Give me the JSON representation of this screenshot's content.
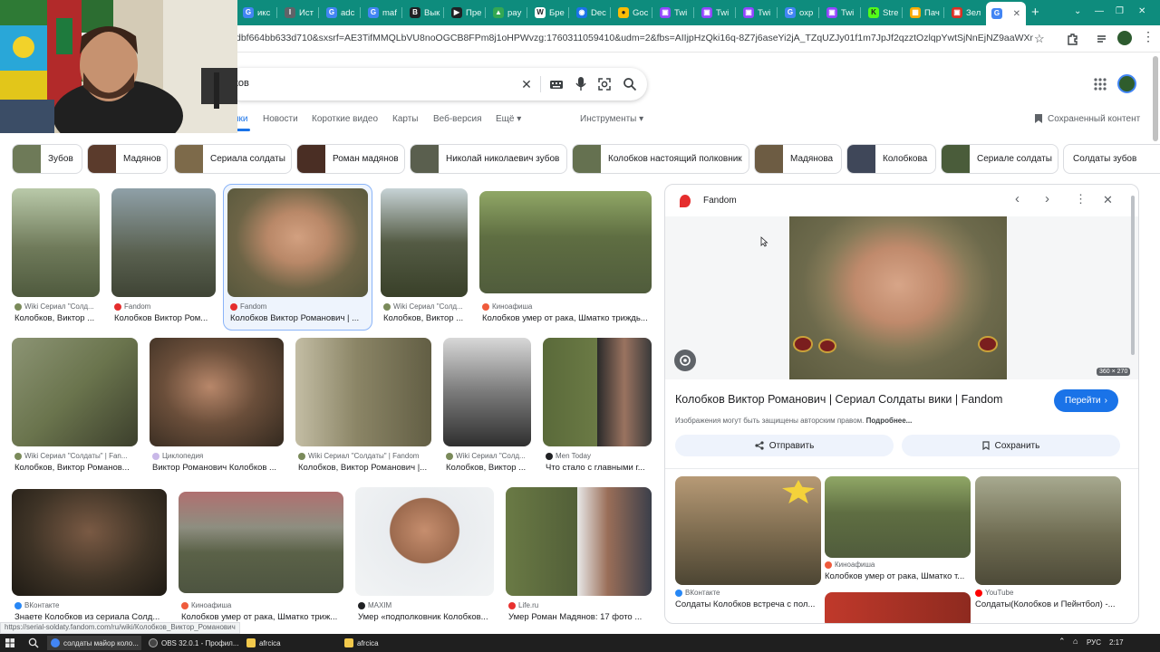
{
  "browser": {
    "tabs": [
      {
        "label": "икс",
        "fav": "G",
        "color": "#4285f4"
      },
      {
        "label": "Ист",
        "fav": "I",
        "color": "#5f6368"
      },
      {
        "label": "adc",
        "fav": "G",
        "color": "#4285f4"
      },
      {
        "label": "maf",
        "fav": "G",
        "color": "#4285f4"
      },
      {
        "label": "Вык",
        "fav": "B",
        "color": "#202124"
      },
      {
        "label": "Пре",
        "fav": "▶",
        "color": "#202124"
      },
      {
        "label": "pay",
        "fav": "▲",
        "color": "#34a853"
      },
      {
        "label": "Бре",
        "fav": "W",
        "color": "#ffffff"
      },
      {
        "label": "Dec",
        "fav": "◉",
        "color": "#1a73e8"
      },
      {
        "label": "Goc",
        "fav": "●",
        "color": "#fbbc04"
      },
      {
        "label": "Twi",
        "fav": "▣",
        "color": "#9146ff"
      },
      {
        "label": "Twi",
        "fav": "▣",
        "color": "#9146ff"
      },
      {
        "label": "Twi",
        "fav": "▣",
        "color": "#9146ff"
      },
      {
        "label": "oxp",
        "fav": "G",
        "color": "#4285f4"
      },
      {
        "label": "Twi",
        "fav": "▣",
        "color": "#9146ff"
      },
      {
        "label": "Stre",
        "fav": "K",
        "color": "#53fc18"
      },
      {
        "label": "Пач",
        "fav": "▦",
        "color": "#f9ab00"
      },
      {
        "label": "Зел",
        "fav": "▣",
        "color": "#d93025"
      }
    ],
    "active_tab": {
      "label": "G",
      "close": "✕"
    },
    "new_tab": "+",
    "window_controls": [
      "⌄",
      "—",
      "❐",
      "✕"
    ],
    "url": "dbf664bb633d710&sxsrf=AE3TifMMQLbVU8noOGCB8FPm8j1oHPWvzg:1760311059410&udm=2&fbs=AIIjpHzQki16q-8Z7j6aseYi2jA_TZqUZJy01f1m7JpJf2qzztOzlqpYwtSjNnEjNZ9aaWXnfX53A6Ow4IhdXAihjv3Lp..."
  },
  "search": {
    "query": "ков",
    "tabs": [
      {
        "label": "нки",
        "active": true
      },
      {
        "label": "Новости"
      },
      {
        "label": "Короткие видео"
      },
      {
        "label": "Карты"
      },
      {
        "label": "Веб-версия"
      },
      {
        "label": "Ещё ▾"
      }
    ],
    "tools": "Инструменты ▾",
    "saved": "Сохраненный контент"
  },
  "chips": [
    "Зубов",
    "Мадянов",
    "Сериала солдаты",
    "Роман мадянов",
    "Николай николаевич зубов",
    "Колобков настоящий полковник",
    "Мадянова",
    "Колобкова",
    "Сериале солдаты",
    "Солдаты зубов"
  ],
  "results": [
    {
      "source": "Wiki Сериал \"Солд...",
      "title": "Колобков, Виктор ..."
    },
    {
      "source": "Fandom",
      "title": "Колобков Виктор Ром..."
    },
    {
      "source": "Fandom",
      "title": "Колобков Виктор Романович | ..."
    },
    {
      "source": "Wiki Сериал \"Солд...",
      "title": "Колобков, Виктор ..."
    },
    {
      "source": "Киноафиша",
      "title": "Колобков умер от рака, Шматко триждь..."
    },
    {
      "source": "Wiki Сериал \"Солдаты\" | Fan...",
      "title": "Колобков, Виктор Романов..."
    },
    {
      "source": "Циклопедия",
      "title": "Виктор Романович Колобков ..."
    },
    {
      "source": "Wiki Сериал \"Солдаты\" | Fandom",
      "title": "Колобков, Виктор Романович |..."
    },
    {
      "source": "Wiki Сериал \"Солд...",
      "title": "Колобков, Виктор ..."
    },
    {
      "source": "Men Today",
      "title": "Что стало с главными г..."
    },
    {
      "source": "ВКонтакте",
      "title": "Знаете Колобков из сериала Солд..."
    },
    {
      "source": "Киноафиша",
      "title": "Колобков умер от рака, Шматко триж..."
    },
    {
      "source": "MAXIM",
      "title": "Умер «подполковник Колобков..."
    },
    {
      "source": "Life.ru",
      "title": "Умер Роман Мадянов: 17 фото ..."
    }
  ],
  "preview": {
    "source": "Fandom",
    "dimensions": "360 × 270",
    "title": "Колобков Виктор Романович | Сериал Солдаты вики | Fandom",
    "visit": "Перейти",
    "copyright": "Изображения могут быть защищены авторским правом.",
    "more": "Подробнее...",
    "share": "Отправить",
    "save": "Сохранить",
    "related": [
      {
        "source": "ВКонтакте",
        "title": "Солдаты Колобков встреча с пол..."
      },
      {
        "source": "Киноафиша",
        "title": "Колобков умер от рака, Шматко т..."
      },
      {
        "source": "YouTube",
        "title": "Солдаты(Колобков и Пейнтбол) -..."
      }
    ]
  },
  "status_url": "https://serial-soldaty.fandom.com/ru/wiki/Колобков_Виктор_Романович",
  "taskbar": {
    "items": [
      "солдаты майор коло...",
      "OBS 32.0.1 - Профил...",
      "afrcica",
      "afrcica"
    ],
    "lang": "РУС",
    "time": "2:17"
  }
}
